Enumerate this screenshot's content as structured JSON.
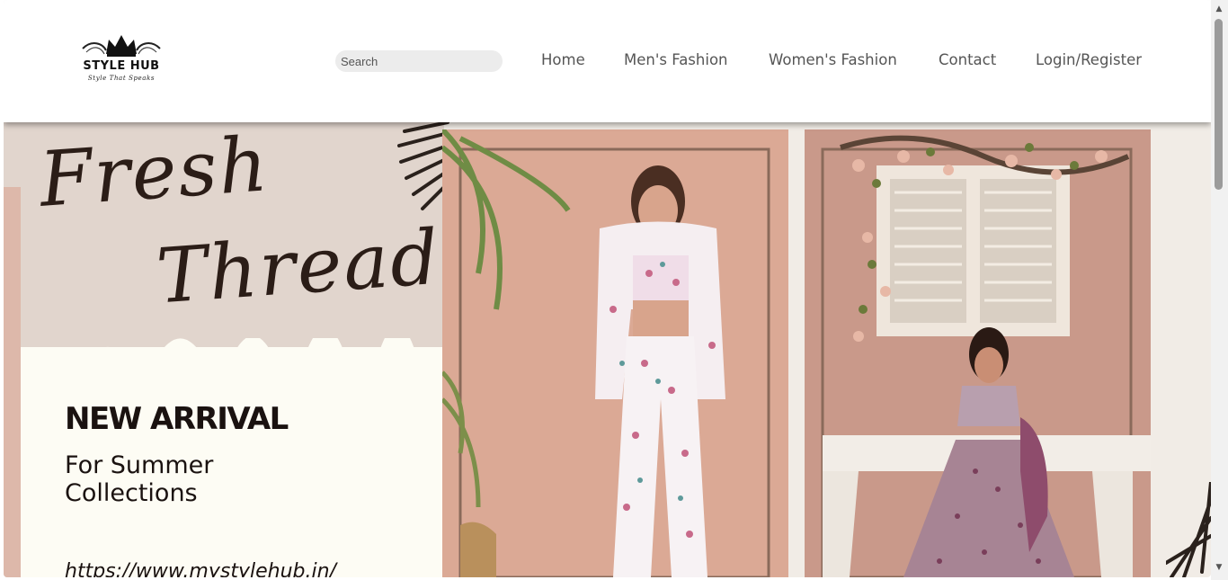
{
  "header": {
    "logo": {
      "brand": "STYLE HUB",
      "tagline": "Style That Speaks",
      "icon": "crown-icon"
    },
    "search": {
      "placeholder": "Search",
      "value": ""
    },
    "nav": [
      "Home",
      "Men's Fashion",
      "Women's Fashion",
      "Contact",
      "Login/Register"
    ]
  },
  "banner": {
    "script_line1": "Fresh",
    "script_line2": "Threads",
    "headline": "NEW ARRIVAL",
    "subheadline": "For Summer Collections",
    "url": "https://www.mystylehub.in/"
  },
  "colors": {
    "left_panel": "#e1d5cd",
    "cream": "#fdfcf4",
    "photo_bg": "#dba995",
    "text_dark": "#1a1210"
  }
}
